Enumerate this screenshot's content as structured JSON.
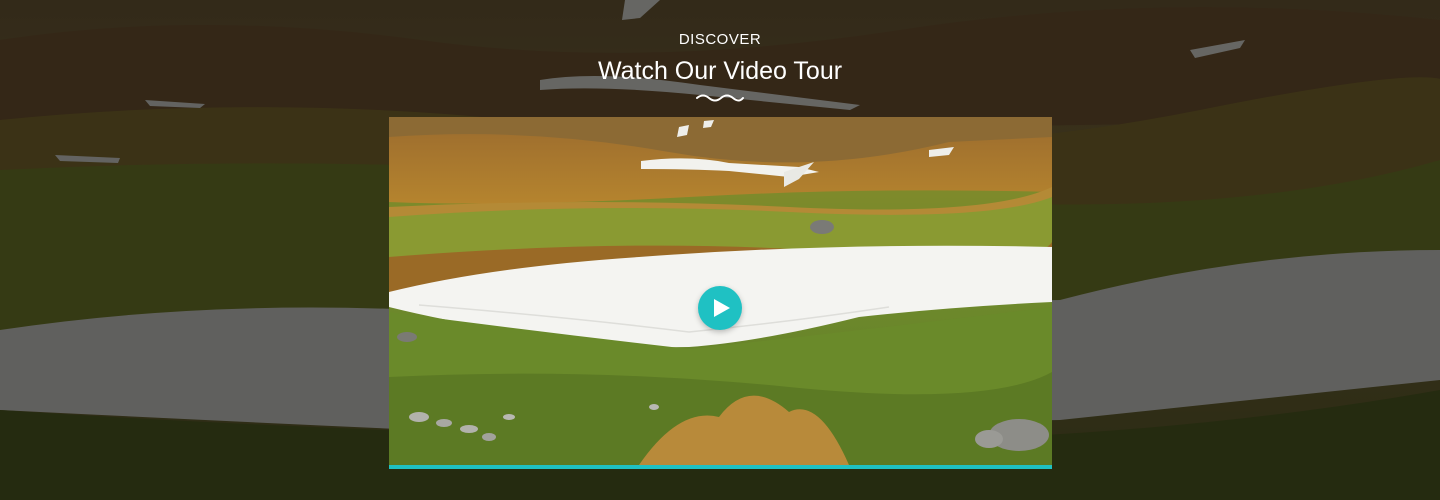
{
  "section": {
    "eyebrow": "DISCOVER",
    "title": "Watch Our Video Tour"
  },
  "video": {
    "play_icon": "play-icon",
    "accent_color": "#1fc1c3"
  },
  "colors": {
    "text": "#ffffff",
    "accent": "#1fc1c3"
  }
}
